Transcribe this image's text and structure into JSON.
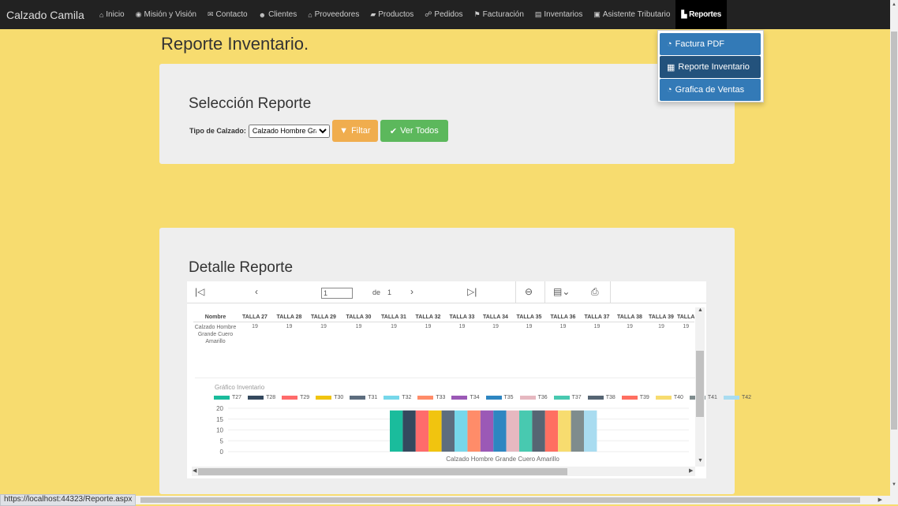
{
  "navbar": {
    "brand": "Calzado Camila",
    "items": [
      {
        "label": "Inicio",
        "icon": "home-icon",
        "glyph": "⌂"
      },
      {
        "label": "Misión y Visión",
        "icon": "eye-icon",
        "glyph": "◉"
      },
      {
        "label": "Contacto",
        "icon": "envelope-icon",
        "glyph": "✉"
      },
      {
        "label": "Clientes",
        "icon": "users-icon",
        "glyph": "☻"
      },
      {
        "label": "Proveedores",
        "icon": "bank-icon",
        "glyph": "⌂"
      },
      {
        "label": "Productos",
        "icon": "book-icon",
        "glyph": "▰"
      },
      {
        "label": "Pedidos",
        "icon": "handshake-icon",
        "glyph": "☍"
      },
      {
        "label": "Facturación",
        "icon": "cart-icon",
        "glyph": "⚑"
      },
      {
        "label": "Inventarios",
        "icon": "list-icon",
        "glyph": "▤"
      },
      {
        "label": "Asistente Tributario",
        "icon": "calendar-icon",
        "glyph": "▣"
      },
      {
        "label": "Reportes",
        "icon": "file-icon",
        "glyph": "▙"
      }
    ]
  },
  "dropdown": {
    "items": [
      {
        "label": "Factura PDF",
        "icon": "pie-chart-icon",
        "glyph": "◔"
      },
      {
        "label": "Reporte Inventario",
        "icon": "table-icon",
        "glyph": "▦"
      },
      {
        "label": "Grafica de Ventas",
        "icon": "pie-chart-icon",
        "glyph": "◔"
      }
    ]
  },
  "page": {
    "title": "Reporte Inventario."
  },
  "selection": {
    "heading": "Selección Reporte",
    "label": "Tipo de Calzado:",
    "selected": "Calzado Hombre Gra",
    "filter_button": "Filtar",
    "all_button": "Ver Todos"
  },
  "detail": {
    "heading": "Detalle Reporte"
  },
  "viewer": {
    "page_current": "1",
    "page_of": "de",
    "page_total": "1"
  },
  "report_table": {
    "headers": [
      "Nombre",
      "TALLA 27",
      "TALLA 28",
      "TALLA 29",
      "TALLA 30",
      "TALLA 31",
      "TALLA 32",
      "TALLA 33",
      "TALLA 34",
      "TALLA 35",
      "TALLA 36",
      "TALLA 37",
      "TALLA 38",
      "TALLA 39",
      "TALLA"
    ],
    "row": [
      "Calzado Hombre Grande Cuero Amarillo",
      "19",
      "19",
      "19",
      "19",
      "19",
      "19",
      "19",
      "19",
      "19",
      "19",
      "19",
      "19",
      "19",
      "19"
    ]
  },
  "chart_data": {
    "type": "bar",
    "title": "Gráfico Inventario",
    "categories": [
      "Calzado Hombre Grande Cuero Amarillo"
    ],
    "series": [
      {
        "name": "T27",
        "values": [
          19
        ],
        "color": "#1abc9c"
      },
      {
        "name": "T28",
        "values": [
          19
        ],
        "color": "#34495e"
      },
      {
        "name": "T29",
        "values": [
          19
        ],
        "color": "#ff6b6b"
      },
      {
        "name": "T30",
        "values": [
          19
        ],
        "color": "#f1c40f"
      },
      {
        "name": "T31",
        "values": [
          19
        ],
        "color": "#5d6d7e"
      },
      {
        "name": "T32",
        "values": [
          19
        ],
        "color": "#76d7ea"
      },
      {
        "name": "T33",
        "values": [
          19
        ],
        "color": "#ff8c69"
      },
      {
        "name": "T34",
        "values": [
          19
        ],
        "color": "#9b59b6"
      },
      {
        "name": "T35",
        "values": [
          19
        ],
        "color": "#2e86c1"
      },
      {
        "name": "T36",
        "values": [
          19
        ],
        "color": "#e6b8c0"
      },
      {
        "name": "T37",
        "values": [
          19
        ],
        "color": "#48c9b0"
      },
      {
        "name": "T38",
        "values": [
          19
        ],
        "color": "#566573"
      },
      {
        "name": "T39",
        "values": [
          19
        ],
        "color": "#ff6f61"
      },
      {
        "name": "T40",
        "values": [
          19
        ],
        "color": "#f7dc6f"
      },
      {
        "name": "T41",
        "values": [
          19
        ],
        "color": "#7f8c8d"
      },
      {
        "name": "T42",
        "values": [
          19
        ],
        "color": "#a9dcf0"
      }
    ],
    "yticks": [
      "20",
      "15",
      "10",
      "5",
      "0"
    ],
    "ylim": [
      0,
      20
    ],
    "legend": "top"
  },
  "status_url": "https://localhost:44323/Reporte.aspx"
}
